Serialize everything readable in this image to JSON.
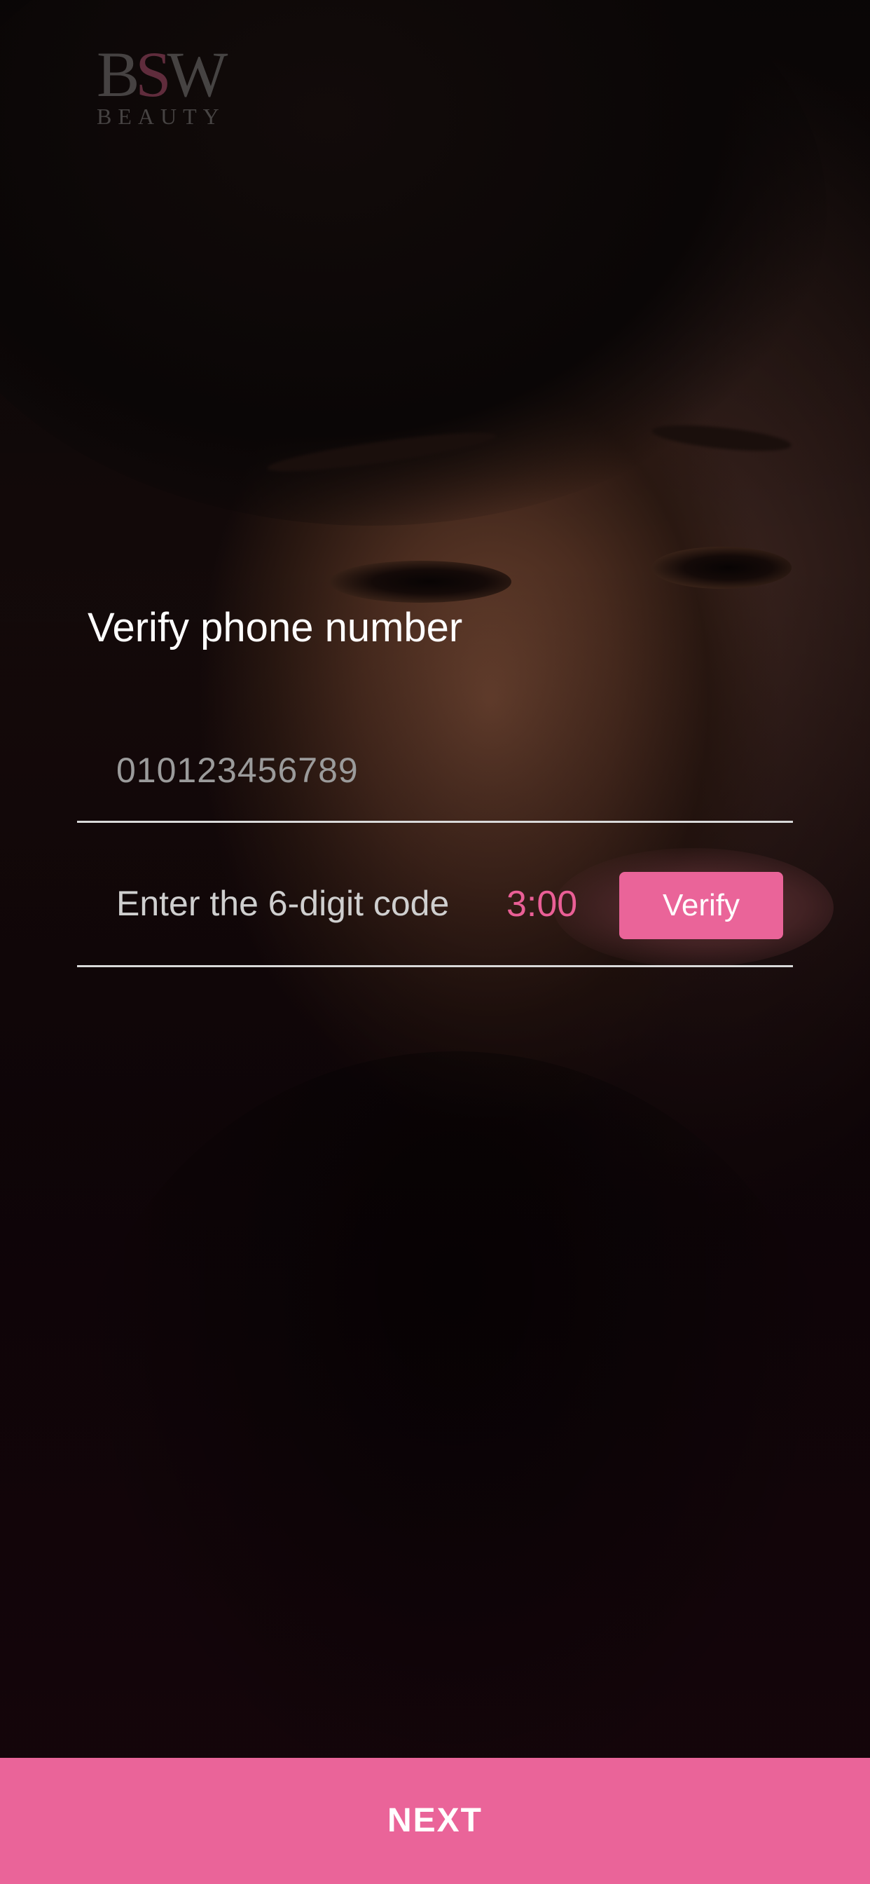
{
  "logo": {
    "mark_left": "B",
    "mark_middle": "S",
    "mark_right": "W",
    "subtitle": "BEAUTY"
  },
  "form": {
    "title": "Verify phone number",
    "phone_value": "010123456789",
    "code_placeholder": "Enter the 6-digit code",
    "timer": "3:00",
    "verify_label": "Verify"
  },
  "footer": {
    "next_label": "NEXT"
  },
  "colors": {
    "accent": "#ea6499",
    "timer": "#ea5f96",
    "divider": "#d9d9d9"
  }
}
